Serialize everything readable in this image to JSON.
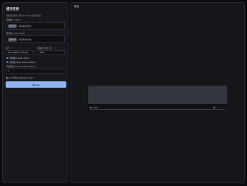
{
  "left": {
    "title": "提交任务",
    "description": "根据配置参数, 进行Spleeter音频分离处理",
    "input_video": {
      "label": "视频输入 (input)",
      "button": "选择文件",
      "file_text": "未选择任何文件"
    },
    "input_image": {
      "label": "图片输入 (img_base)",
      "button": "选择文件",
      "file_text": "未选择任何文件"
    },
    "model": {
      "label": "模型",
      "value": "Lite (realtime_change)",
      "help": "?"
    },
    "max_duration": {
      "label": "视频最大时长 (秒)",
      "help": "?",
      "value": "3600"
    },
    "radios": [
      {
        "label": "视频保存 (align_audio)",
        "checked": true
      },
      {
        "label": "纯音频 (align_audio_reverse)",
        "checked": false
      }
    ],
    "start_second": {
      "label": "开始秒数 (format_start_seconds)",
      "help": "?",
      "value": "0"
    },
    "checkbox": {
      "label": "人声分离 (separate_vocal)",
      "help": "?"
    },
    "run_button": "Run ▶"
  },
  "right": {
    "title": "输出",
    "player": {
      "play": "▶",
      "time": "0:00",
      "speaker": "🔊",
      "fullscreen": "⛶",
      "more": "⋮"
    }
  }
}
